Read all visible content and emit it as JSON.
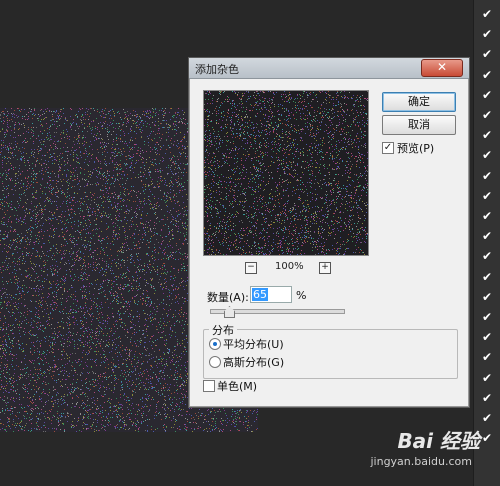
{
  "dialog": {
    "title": "添加杂色",
    "close_label": "✕",
    "ok_label": "确定",
    "cancel_label": "取消",
    "preview_label": "预览(P)",
    "preview_checked": true,
    "zoom_out": "−",
    "zoom_in": "+",
    "zoom_level": "100%",
    "amount_label": "数量(A):",
    "amount_value": "65",
    "amount_unit": "%",
    "amount_percent": 65,
    "distribution_title": "分布",
    "uniform_label": "平均分布(U)",
    "gaussian_label": "高斯分布(G)",
    "selected_distribution": "uniform",
    "mono_label": "单色(M)",
    "mono_checked": false
  },
  "right_panel": {
    "check_glyph": "✔",
    "count": 22
  },
  "watermark": {
    "brand": "Bai 经验",
    "url": "jingyan.baidu.com"
  },
  "colors": {
    "accent": "#3399ff",
    "noise_base": "#2a2830"
  }
}
